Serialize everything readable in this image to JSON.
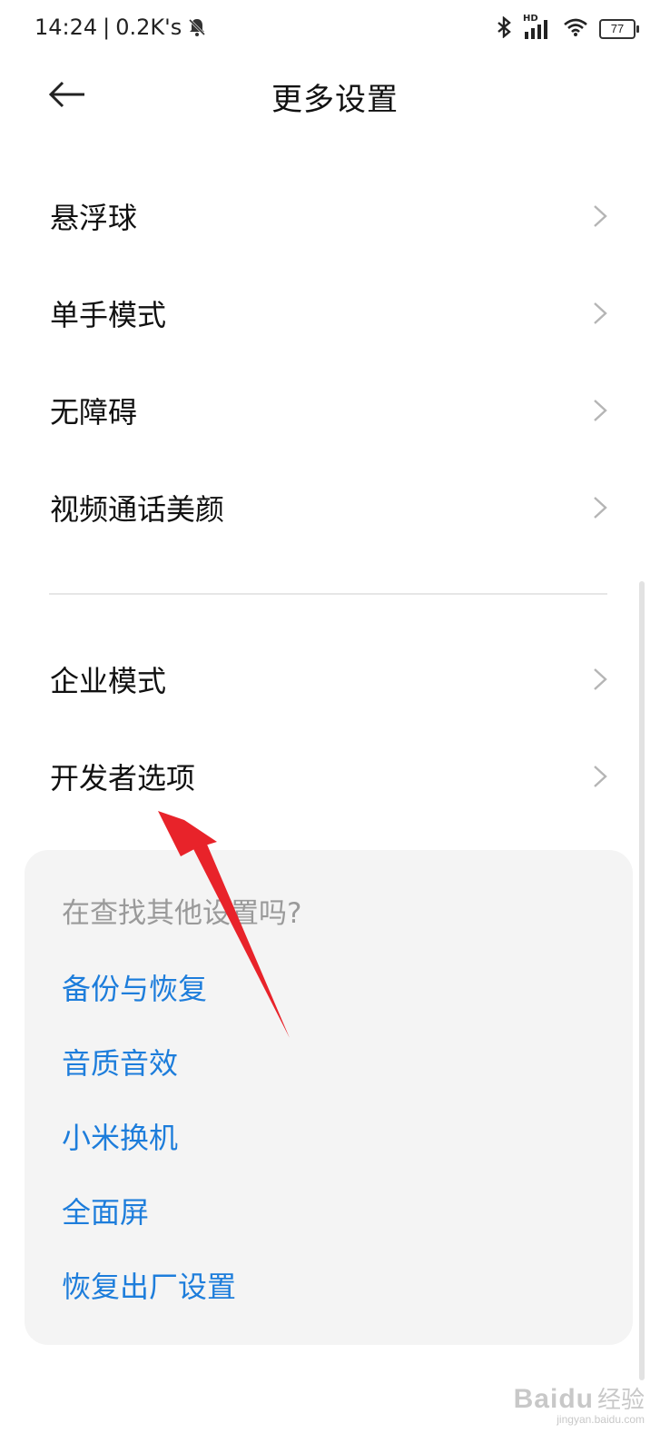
{
  "status_bar": {
    "time": "14:24",
    "separator": "|",
    "speed": "0.2K's",
    "network_badge": "HD",
    "battery": "77"
  },
  "header": {
    "title": "更多设置"
  },
  "menu": {
    "items": [
      {
        "label": "悬浮球"
      },
      {
        "label": "单手模式"
      },
      {
        "label": "无障碍"
      },
      {
        "label": "视频通话美颜"
      },
      {
        "label": "企业模式"
      },
      {
        "label": "开发者选项"
      }
    ]
  },
  "search_card": {
    "title": "在查找其他设置吗?",
    "links": [
      {
        "label": "备份与恢复"
      },
      {
        "label": "音质音效"
      },
      {
        "label": "小米换机"
      },
      {
        "label": "全面屏"
      },
      {
        "label": "恢复出厂设置"
      }
    ]
  },
  "annotation": {
    "arrow_color": "#e8232a"
  },
  "watermark": {
    "brand": "Baidu",
    "brand_cn": "经验",
    "site": "jingyan.baidu.com"
  },
  "colors": {
    "link": "#1d7ddb",
    "card_bg": "#f4f4f4"
  }
}
